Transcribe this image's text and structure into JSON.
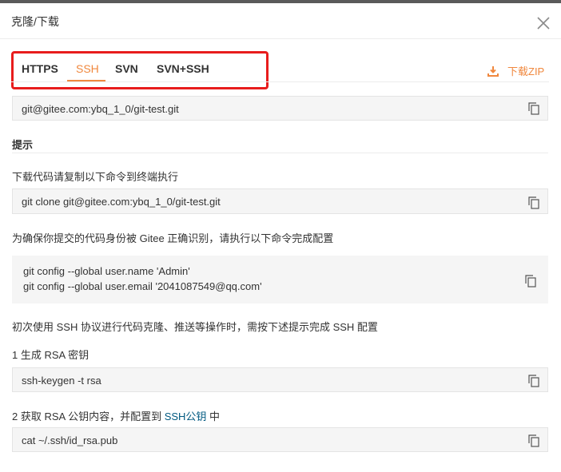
{
  "dialog": {
    "title": "克隆/下载"
  },
  "tabs": [
    {
      "label": "HTTPS"
    },
    {
      "label": "SSH"
    },
    {
      "label": "SVN"
    },
    {
      "label": "SVN+SSH"
    }
  ],
  "active_tab": "SSH",
  "download": {
    "label": "下载ZIP"
  },
  "repo_url": "git@gitee.com:ybq_1_0/git-test.git",
  "tips": {
    "heading": "提示",
    "clone_intro": "下载代码请复制以下命令到终端执行",
    "clone_cmd": "git clone git@gitee.com:ybq_1_0/git-test.git",
    "identity_intro": "为确保你提交的代码身份被 Gitee 正确识别，请执行以下命令完成配置",
    "config_name": "git config --global user.name 'Admin'",
    "config_email": "git config --global user.email '2041087549@qq.com'",
    "ssh_intro": "初次使用 SSH 协议进行代码克隆、推送等操作时，需按下述提示完成 SSH 配置",
    "step1": "1 生成 RSA 密钥",
    "step1_cmd": "ssh-keygen -t rsa",
    "step2_prefix": "2 获取 RSA 公钥内容，并配置到 ",
    "step2_link": "SSH公钥",
    "step2_suffix": " 中",
    "step2_cmd": "cat ~/.ssh/id_rsa.pub"
  },
  "colors": {
    "accent": "#f0883e",
    "highlight_border": "#e81c1c",
    "link": "#005980"
  },
  "icons": [
    "close-icon",
    "download-icon",
    "copy-icon"
  ]
}
